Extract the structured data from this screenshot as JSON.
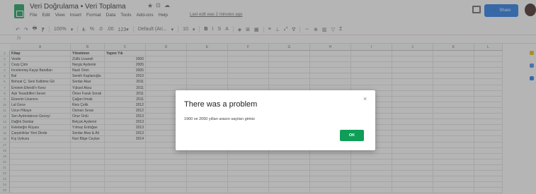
{
  "window": {
    "doc_title": "Veri Doğrulama • Veri Toplama",
    "last_edit": "Last edit was 2 minutes ago",
    "menu": [
      "File",
      "Edit",
      "View",
      "Insert",
      "Format",
      "Data",
      "Tools",
      "Add-ons",
      "Help"
    ],
    "share_label": "Share",
    "icons": {
      "star": "★",
      "move": "⊡",
      "cloud": "☁",
      "share": "👤"
    }
  },
  "toolbar": {
    "items": [
      "↶",
      "↷",
      "🖶",
      "⁋",
      "100%",
      "▾",
      "₺",
      "%",
      ".0",
      ".00",
      "123▾",
      "Default (Ari...",
      "▾",
      "10",
      "▾"
    ],
    "format_items": [
      "B",
      "I",
      "S",
      "A",
      "◈",
      "⊞",
      "▦",
      "≡",
      "⊥",
      "⤢",
      "∇",
      "⇔",
      "⊕",
      "▥",
      "▽",
      "Σ"
    ]
  },
  "formula_bar": {
    "fx": "fx"
  },
  "grid": {
    "columns": [
      "A",
      "B",
      "C",
      "D",
      "E",
      "F",
      "G",
      "H",
      "I",
      "J",
      "K",
      "L"
    ],
    "headers": [
      "Kitap",
      "Yönetmen",
      "Yapım Yılı"
    ],
    "rows": [
      [
        "Vesile",
        "Zülfü Livaneli",
        "2000"
      ],
      [
        "Cezp Çimi",
        "Nergiz Aydemir",
        "2005"
      ],
      [
        "Incelenmiş Kayıp Bandları",
        "Nazlı Oren",
        "2005"
      ],
      [
        "Bal",
        "Semih Kaplanoğlu",
        "2010"
      ],
      [
        "Behzat Ç. Seni Kalbime Gö",
        "Serdar Akar",
        "2011"
      ],
      [
        "Eminim Efendi'n Kenz",
        "Yüksel Aksu",
        "2011"
      ],
      [
        "Aşk Tesadüfleri Sever",
        "Ömer Faruk Sorak",
        "2011"
      ],
      [
        "Eksenin Uzanırsı",
        "Çağan Irmak",
        "2011"
      ],
      [
        "Lal Gece",
        "Reis Çelik",
        "2012"
      ],
      [
        "Uzun Hikaye",
        "Osman Sınav",
        "2012"
      ],
      [
        "Sen Aydınlatırsın Geceyi",
        "Onur Ünlü",
        "2013"
      ],
      [
        "Dağlık Damlar",
        "Belçuk Aydemir",
        "2013"
      ],
      [
        "Kelebeğin Rüyası",
        "Yılmaz Erdoğan",
        "2013"
      ],
      [
        "Çarpıklıklar Yeni Dinde",
        "Serdar Akar & Ali",
        "2013"
      ],
      [
        "Kış Uykusu",
        "Nuri Bilge Ceylan",
        "2014"
      ]
    ],
    "row_numbers": [
      "1",
      "2",
      "3",
      "4",
      "5",
      "6",
      "7",
      "8",
      "9",
      "10",
      "11",
      "12",
      "13",
      "14",
      "15",
      "16",
      "17",
      "18",
      "19",
      "20",
      "21",
      "22",
      "23",
      "24",
      "25"
    ]
  },
  "dialog": {
    "title": "There was a problem",
    "message": "1960 ve 2050 yılları arasın sayıları giriniz",
    "ok_label": "OK",
    "close_glyph": "×"
  },
  "colors": {
    "sheets_green": "#0f9d58",
    "share_blue": "#1a73e8",
    "ok_green": "#0f9d58"
  }
}
